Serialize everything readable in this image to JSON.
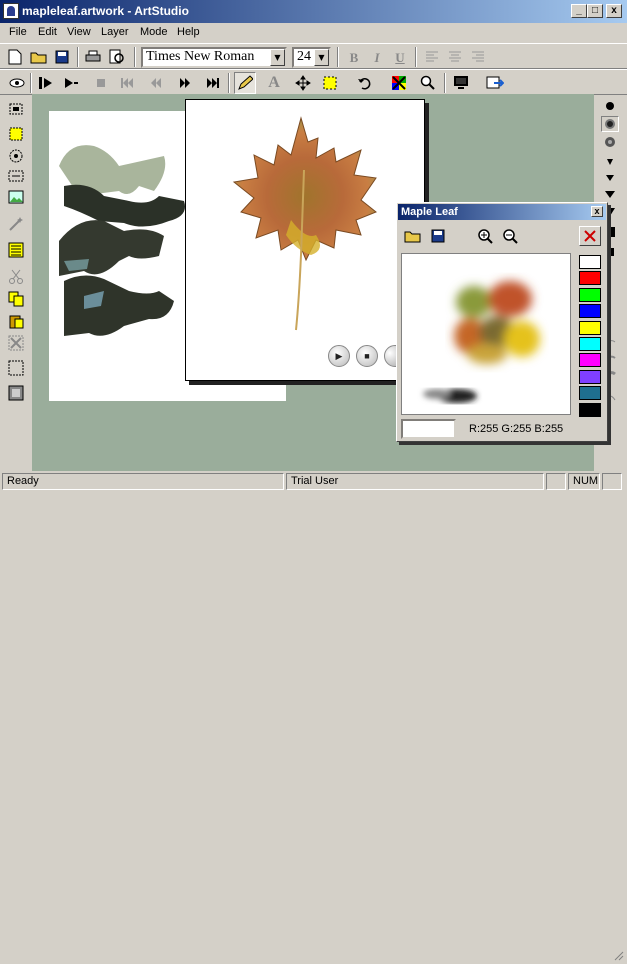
{
  "window": {
    "title": "mapleleaf.artwork - ArtStudio",
    "minimize_label": "_",
    "maximize_label": "□",
    "close_label": "x"
  },
  "menu": {
    "items": [
      "File",
      "Edit",
      "View",
      "Layer",
      "Mode",
      "Help"
    ]
  },
  "toolbar": {
    "font_name": "Times New Roman",
    "font_size": "24",
    "bold_label": "B",
    "italic_label": "I",
    "underline_label": "U"
  },
  "palette_window": {
    "title": "Maple Leaf",
    "close_label": "x",
    "rgb_readout": "R:255 G:255 B:255",
    "swatches": [
      "#ffffff",
      "#ff0000",
      "#00ff00",
      "#0000ff",
      "#ffff00",
      "#00ffff",
      "#ff00ff",
      "#7f3fff",
      "#1f6f8f",
      "#000000"
    ]
  },
  "status": {
    "ready": "Ready",
    "user": "Trial User",
    "num": "NUM"
  },
  "colors": {
    "workspace": "#9aad9b",
    "title_start": "#0a246a",
    "title_end": "#a6caf0",
    "chrome": "#d4d0c8"
  }
}
